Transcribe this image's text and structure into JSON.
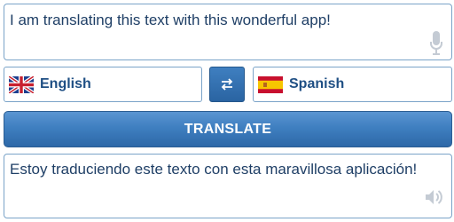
{
  "source": {
    "text": "I am translating this text with this wonderful app!",
    "icon": "microphone-icon"
  },
  "languages": {
    "from": {
      "label": "English",
      "flag": "uk-flag-icon"
    },
    "to": {
      "label": "Spanish",
      "flag": "spain-flag-icon"
    },
    "swap_icon": "swap-arrows-icon"
  },
  "translate_button": {
    "label": "TRANSLATE"
  },
  "target": {
    "text": "Estoy traduciendo este texto con esta maravillosa aplicación!",
    "icon": "speaker-icon"
  },
  "colors": {
    "text": "#1f3f66",
    "border": "#7aa3c8",
    "button": "#3f7fc0"
  }
}
